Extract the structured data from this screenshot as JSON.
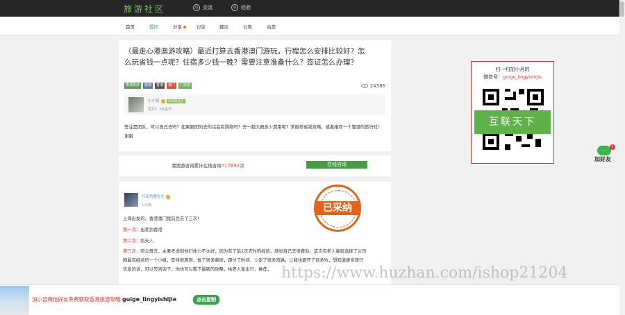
{
  "header": {
    "logo": "旅游社区",
    "nav": [
      {
        "label": "交流",
        "icon": "chat-icon"
      },
      {
        "label": "经验",
        "icon": "experience-icon"
      }
    ]
  },
  "subnav": {
    "items": [
      "首页",
      "提问",
      "分享",
      "讨论",
      "建议",
      "公告",
      "动态"
    ],
    "active_index": 1,
    "dot_index": 2
  },
  "question": {
    "title": "（最走心港澳游攻略）最近打算去香港澳门游玩，行程怎么安排比较好？怎么玩省钱一点呢？住宿多少钱一晚？需要注意准备什么？签证怎么办理？",
    "tags": [
      {
        "label": "香港旅游",
        "color": "#5a9e4c"
      },
      {
        "label": "旅游",
        "color": "#5a7ea8"
      },
      {
        "label": "香港",
        "color": "#555555"
      },
      {
        "label": "澳门",
        "color": "#e34d31"
      },
      {
        "label": "门票游",
        "color": "#6fb74e"
      }
    ],
    "views": "24386",
    "author": {
      "name": "小小寂",
      "level": "LV初级会员",
      "meta": "提问：66金币"
    },
    "body": "签注是团队，可以自己去吗？如果跟团的去的话会有购物吗？去一趟大概多少费用呢？求推荐省钱攻略，或者推荐一个靠谱的旅行社！谢谢"
  },
  "consult": {
    "prefix": "港澳游咨询累计在线咨询",
    "count": "717892",
    "suffix": "次",
    "button": "在线咨询"
  },
  "answer": {
    "author": "行走的鹿先生",
    "time": "1天前",
    "adopted_label": "已采纳",
    "intro": "上海出发的，香港澳门我前后去了三次！",
    "first_label": "第一次：",
    "first_text": "出差到香港",
    "second_label": "第二次：",
    "second_text": "陪夫人",
    "third_label": "第三次：",
    "third_text": "陪父母去，主要考虑到他们体力不太好，因为有了前2次去时的经验，感觉自己去很费劲，这次有老人我就选择了公司网最有经验的一个小组，安排很周到，省了很多麻烦，跟付了时间，少走了很多弯路，让我也避开了很多坑，想知道更多旅行信息的话，可以先咨询下，你也可以看下最新的攻略，给老人家出行，推荐，"
  },
  "qr_card": {
    "line1": "扫一扫加小月的",
    "line2_prefix": "微信号：",
    "wechat_id": "guige_lingyishijie",
    "banner": "互联天下"
  },
  "add_friend": {
    "label": "加好友",
    "badge": "1",
    "bubble": "..."
  },
  "watermark": "https://www.huzhan.com/ishop21204",
  "bottom_bar": {
    "text": "加小吕微信好友免费获取香港旅游攻略",
    "wechat_id": "guige_lingyishijie",
    "copy_button": "点击复制"
  }
}
